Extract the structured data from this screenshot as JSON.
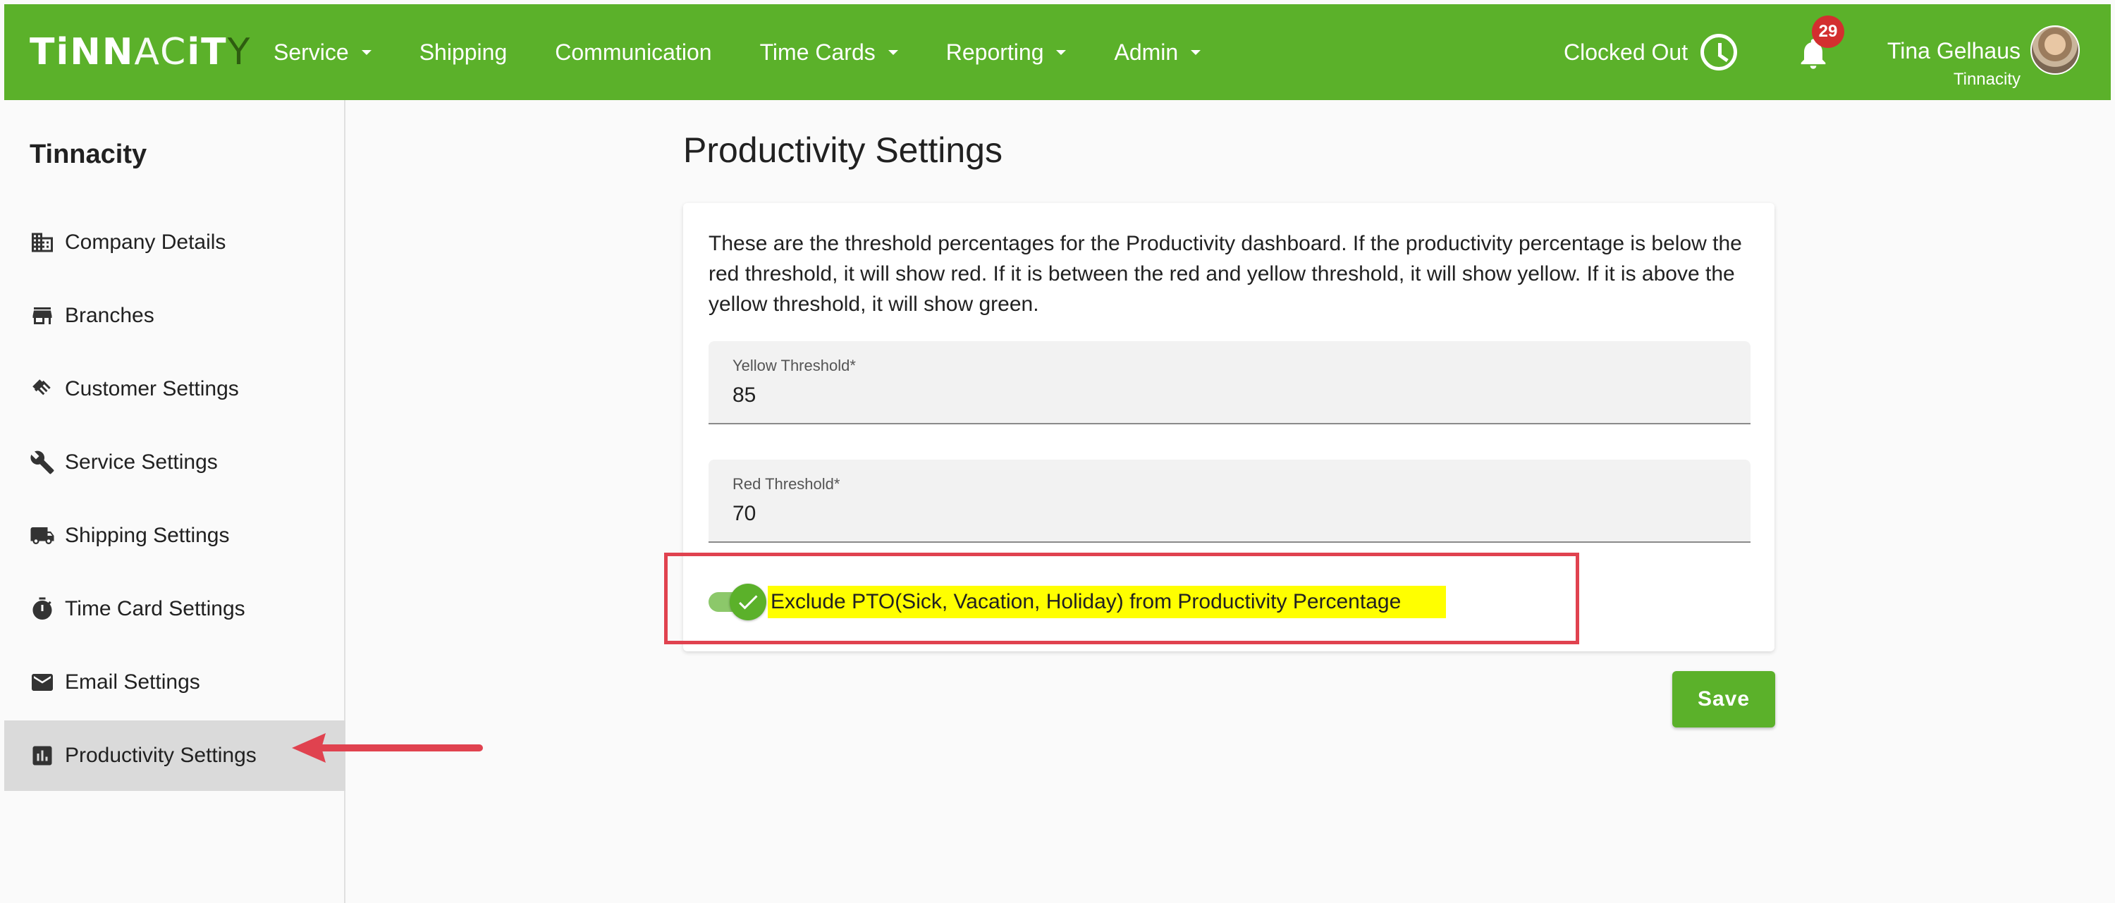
{
  "topbar": {
    "logo": {
      "part1": "TiNN",
      "part2": "AC",
      "part3": "iT",
      "part4": "Y"
    },
    "nav": [
      {
        "label": "Service",
        "dropdown": true
      },
      {
        "label": "Shipping",
        "dropdown": false
      },
      {
        "label": "Communication",
        "dropdown": false
      },
      {
        "label": "Time Cards",
        "dropdown": true
      },
      {
        "label": "Reporting",
        "dropdown": true
      },
      {
        "label": "Admin",
        "dropdown": true
      }
    ],
    "clock_status": "Clocked Out",
    "notifications_count": "29",
    "user_name": "Tina Gelhaus",
    "user_org": "Tinnacity",
    "accent_color": "#5bb12a"
  },
  "sidebar": {
    "title": "Tinnacity",
    "items": [
      {
        "label": "Company Details",
        "icon": "building-icon"
      },
      {
        "label": "Branches",
        "icon": "store-icon"
      },
      {
        "label": "Customer Settings",
        "icon": "handshake-icon"
      },
      {
        "label": "Service Settings",
        "icon": "wrench-icon"
      },
      {
        "label": "Shipping Settings",
        "icon": "truck-icon"
      },
      {
        "label": "Time Card Settings",
        "icon": "stopwatch-icon"
      },
      {
        "label": "Email Settings",
        "icon": "mail-icon"
      },
      {
        "label": "Productivity Settings",
        "icon": "bar-chart-icon",
        "active": true
      }
    ]
  },
  "main": {
    "title": "Productivity Settings",
    "description": "These are the threshold percentages for the Productivity dashboard. If the productivity percentage is below the red threshold, it will show red. If it is between the red and yellow threshold, it will show yellow. If it is above the yellow threshold, it will show green.",
    "yellow_threshold": {
      "label": "Yellow Threshold*",
      "value": "85"
    },
    "red_threshold": {
      "label": "Red Threshold*",
      "value": "70"
    },
    "exclude_pto": {
      "label": "Exclude PTO(Sick, Vacation, Holiday) from Productivity Percentage",
      "checked": true
    },
    "save_label": "Save"
  }
}
